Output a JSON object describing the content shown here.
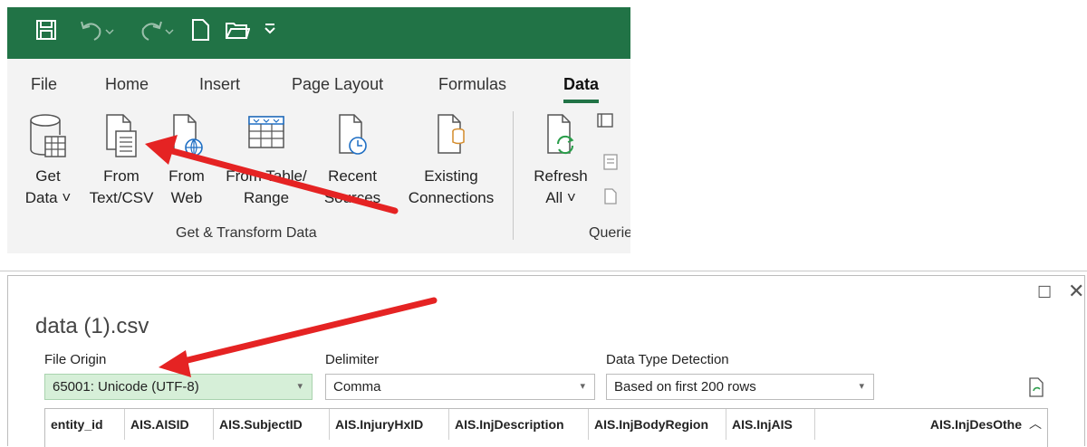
{
  "ribbon": {
    "tabs": [
      "File",
      "Home",
      "Insert",
      "Page Layout",
      "Formulas",
      "Data"
    ],
    "active_tab": "Data",
    "accent_color": "#217346",
    "buttons": {
      "get_data": {
        "line1": "Get",
        "line2": "Data ˅"
      },
      "from_text_csv": {
        "line1": "From",
        "line2": "Text/CSV"
      },
      "from_web": {
        "line1": "From",
        "line2": "Web"
      },
      "from_table": {
        "line1": "From Table/",
        "line2": "Range"
      },
      "recent_sources": {
        "line1": "Recent",
        "line2": "Sources"
      },
      "existing_connections": {
        "line1": "Existing",
        "line2": "Connections"
      },
      "refresh_all": {
        "line1": "Refresh",
        "line2": "All ˅"
      }
    },
    "groups": {
      "get_transform": "Get & Transform Data",
      "queries": "Querie"
    }
  },
  "dialog": {
    "title": "data (1).csv",
    "file_origin": {
      "label": "File Origin",
      "value": "65001: Unicode (UTF-8)"
    },
    "delimiter": {
      "label": "Delimiter",
      "value": "Comma"
    },
    "data_type_detection": {
      "label": "Data Type Detection",
      "value": "Based on first 200 rows"
    },
    "columns": [
      "entity_id",
      "AIS.AISID",
      "AIS.SubjectID",
      "AIS.InjuryHxID",
      "AIS.InjDescription",
      "AIS.InjBodyRegion",
      "AIS.InjAIS",
      "AIS.InjDesOthe"
    ]
  }
}
